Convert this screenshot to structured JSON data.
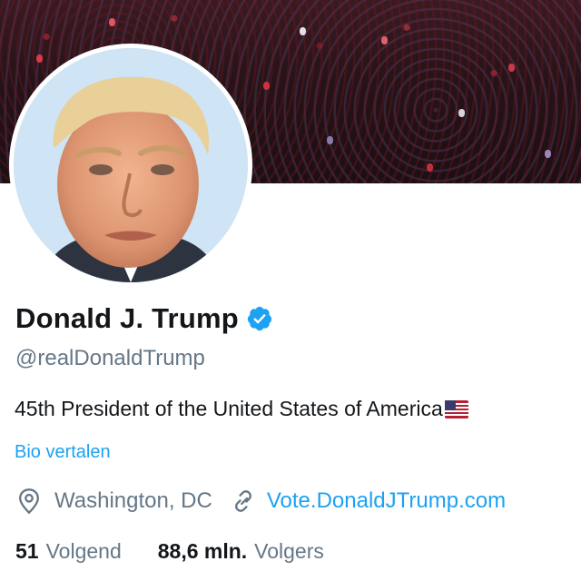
{
  "profile": {
    "name": "Donald J. Trump",
    "handle": "@realDonaldTrump",
    "bio": "45th President of the United States of America",
    "bio_flag_icon": "us-flag-icon",
    "translate_label": "Bio vertalen",
    "location": "Washington, DC",
    "location_icon": "location-pin-icon",
    "link_icon": "link-icon",
    "website": "Vote.DonaldJTrump.com",
    "verified_icon": "verified-badge-icon"
  },
  "stats": {
    "following_count": "51",
    "following_label": "Volgend",
    "followers_count": "88,6 mln.",
    "followers_label": "Volgers"
  },
  "colors": {
    "accent": "#1da1f2",
    "secondary_text": "#657786",
    "primary_text": "#14171a",
    "verified": "#1da1f2"
  }
}
